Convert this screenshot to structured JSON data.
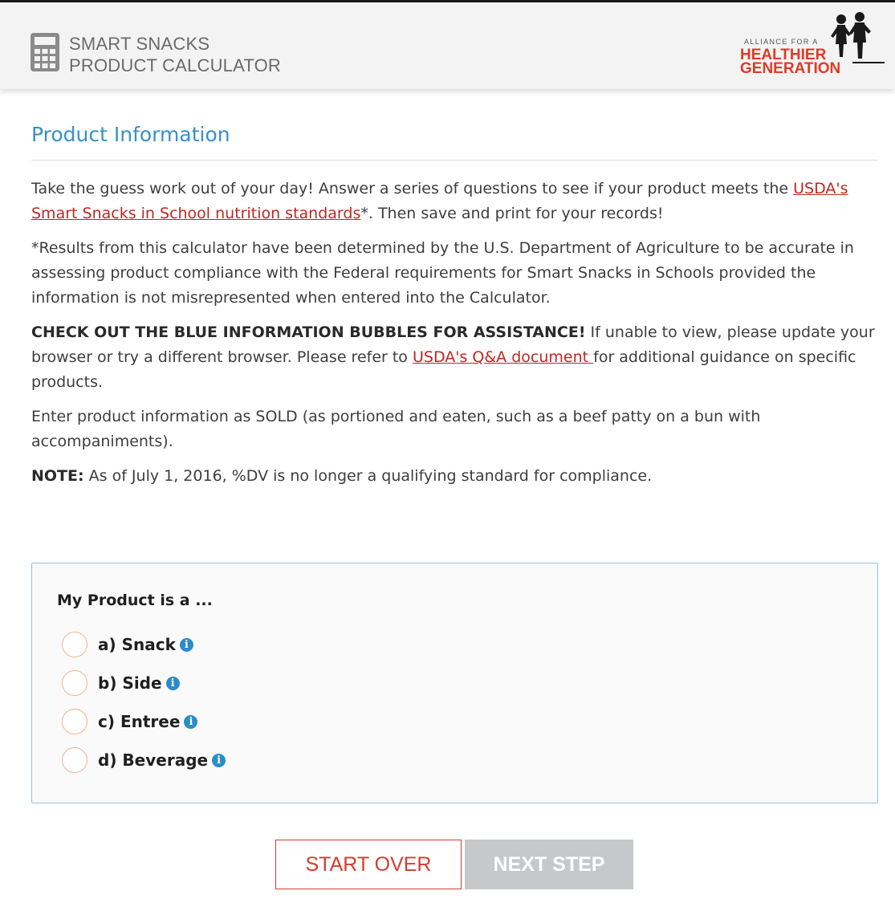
{
  "header": {
    "title_line1": "SMART SNACKS",
    "title_line2": "PRODUCT CALCULATOR",
    "logo": {
      "small": "ALLIANCE FOR A",
      "line1": "HEALTHIER",
      "line2": "GENERATION"
    }
  },
  "section": {
    "title": "Product Information"
  },
  "intro": {
    "p1_before": "Take the guess work out of your day! Answer a series of questions to see if  your product meets the ",
    "p1_link": "USDA's Smart Snacks in School nutrition standards",
    "p1_after": "*. Then save and print for your records!",
    "p2": "*Results from this calculator have been determined by the U.S. Department of Agriculture to be accurate in assessing product compliance with the Federal requirements for Smart Snacks in Schools provided the information is not misrepresented when entered into the Calculator.",
    "p3_bold": "CHECK OUT THE BLUE INFORMATION BUBBLES FOR ASSISTANCE!",
    "p3_text": " If unable to view, please update your browser or try a different browser.  Please refer to ",
    "p3_link": "USDA's Q&A document ",
    "p3_after": "for additional guidance on specific products.",
    "p4": "Enter product information as SOLD (as portioned and eaten, such as a beef patty on a bun with accompaniments).",
    "p5_bold": "NOTE:",
    "p5_text": " As of July 1, 2016, %DV is no longer a qualifying standard for compliance."
  },
  "question": {
    "label": "My Product is a ...",
    "options": [
      {
        "label": "a) Snack",
        "selected": false
      },
      {
        "label": "b) Side",
        "selected": false
      },
      {
        "label": "c) Entree",
        "selected": false
      },
      {
        "label": "d) Beverage",
        "selected": false
      }
    ]
  },
  "buttons": {
    "start_over": "START OVER",
    "next_step": "NEXT STEP"
  },
  "colors": {
    "accent_blue": "#3a8fc7",
    "link_red": "#c0271f",
    "button_red": "#d43c2c",
    "disabled_gray": "#c6c8ca"
  }
}
